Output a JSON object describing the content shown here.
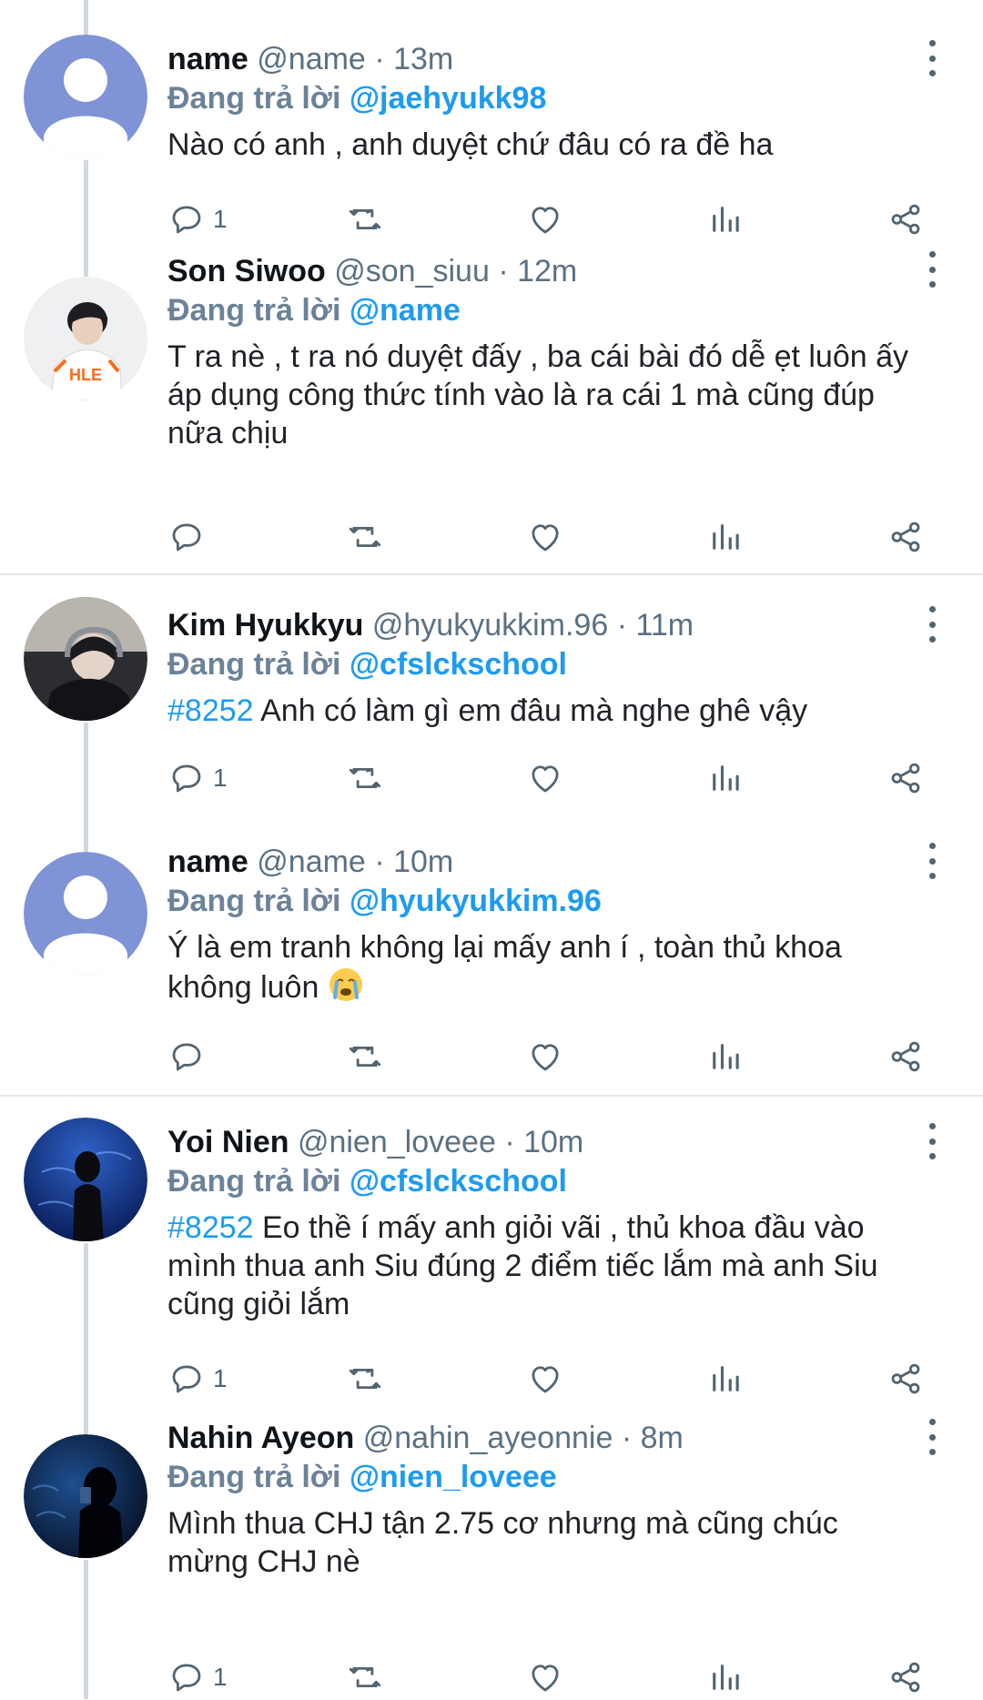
{
  "reply_prefix": "Đang trả lời",
  "icons": {
    "reply": "comment-icon",
    "retweet": "retweet-icon",
    "like": "heart-icon",
    "views": "bar-chart-icon",
    "share": "share-icon",
    "more": "more-vertical-icon"
  },
  "colors": {
    "link": "#1d9bf0",
    "muted": "#5b7083",
    "divider": "#e3e6e8"
  },
  "tweets": [
    {
      "name": "name",
      "handle": "@name",
      "sep": "·",
      "time": "13m",
      "reply_to": "@jaehyukk98",
      "hashtag": "",
      "text": "Nào có anh , anh duyệt chứ đâu có ra đề ha",
      "reply_count": "1",
      "avatar_icon": "default-user-avatar-icon"
    },
    {
      "name": "Son Siwoo",
      "handle": "@son_siuu",
      "sep": "·",
      "time": "12m",
      "reply_to": "@name",
      "hashtag": "",
      "text": "T ra nè , t ra nó duyệt đấy , ba cái bài đó dễ ẹt luôn ấy áp dụng công thức tính vào là ra cái 1 mà cũng đúp nữa chịu",
      "reply_count": "",
      "avatar_icon": "profile-photo-person-icon",
      "avatar_text": "HLE"
    },
    {
      "name": "Kim Hyukkyu",
      "handle": "@hyukyukkim.96",
      "sep": "·",
      "time": "11m",
      "reply_to": "@cfslckschool",
      "hashtag": "#8252",
      "text": " Anh có làm gì em đâu mà nghe ghê vậy",
      "reply_count": "1",
      "avatar_icon": "profile-photo-headset-icon"
    },
    {
      "name": "name",
      "handle": "@name",
      "sep": "·",
      "time": "10m",
      "reply_to": "@hyukyukkim.96",
      "hashtag": "",
      "text": "Ý là em tranh không lại mấy anh í , toàn thủ khoa không luôn ",
      "reply_count": "",
      "avatar_icon": "default-user-avatar-icon",
      "emoji": "crying-face-emoji"
    },
    {
      "name": "Yoi Nien",
      "handle": "@nien_loveee",
      "sep": "·",
      "time": "10m",
      "reply_to": "@cfslckschool",
      "hashtag": "#8252",
      "text": " Eo thề í mấy anh giỏi vãi , thủ khoa đầu vào mình thua anh Siu đúng 2 điểm tiếc lắm mà anh Siu cũng giỏi lắm",
      "reply_count": "1",
      "avatar_icon": "profile-photo-aquarium-icon"
    },
    {
      "name": "Nahin Ayeon",
      "handle": "@nahin_ayeonnie",
      "sep": "·",
      "time": "8m",
      "reply_to": "@nien_loveee",
      "hashtag": "",
      "text": "Mình thua CHJ tận 2.75 cơ nhưng mà cũng chúc mừng CHJ nè",
      "reply_count": "1",
      "avatar_icon": "profile-photo-aquarium-icon"
    }
  ]
}
